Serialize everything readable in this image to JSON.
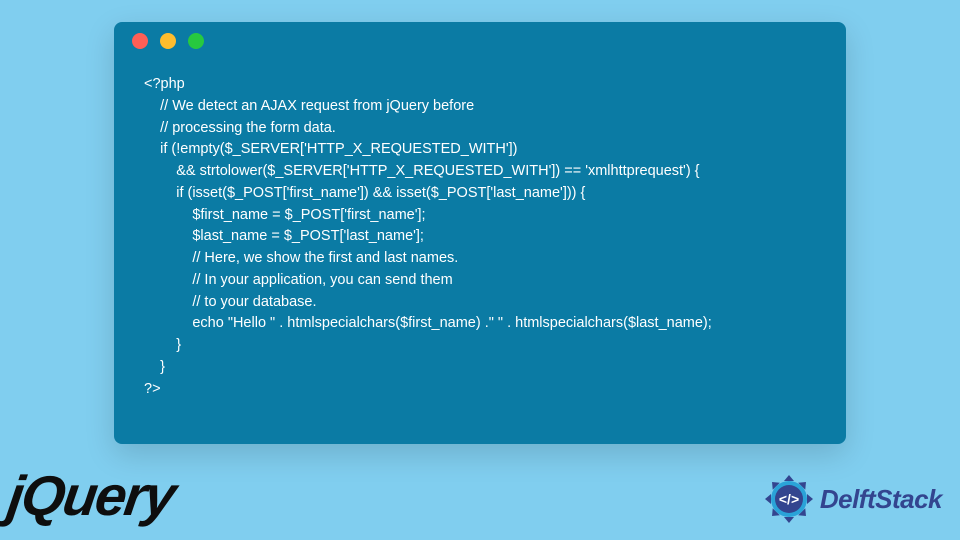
{
  "window": {
    "dots": [
      "red",
      "yellow",
      "green"
    ]
  },
  "code": {
    "lines": [
      "<?php",
      "    // We detect an AJAX request from jQuery before",
      "    // processing the form data.",
      "    if (!empty($_SERVER['HTTP_X_REQUESTED_WITH'])",
      "        && strtolower($_SERVER['HTTP_X_REQUESTED_WITH']) == 'xmlhttprequest') {",
      "        if (isset($_POST['first_name']) && isset($_POST['last_name'])) {",
      "            $first_name = $_POST['first_name'];",
      "            $last_name = $_POST['last_name'];",
      "            // Here, we show the first and last names.",
      "            // In your application, you can send them",
      "            // to your database.",
      "            echo \"Hello \" . htmlspecialchars($first_name) .\" \" . htmlspecialchars($last_name);",
      "        }",
      "    }",
      "?>"
    ]
  },
  "footer": {
    "jquery_label": "jQuery",
    "delft_label": "DelftStack"
  }
}
